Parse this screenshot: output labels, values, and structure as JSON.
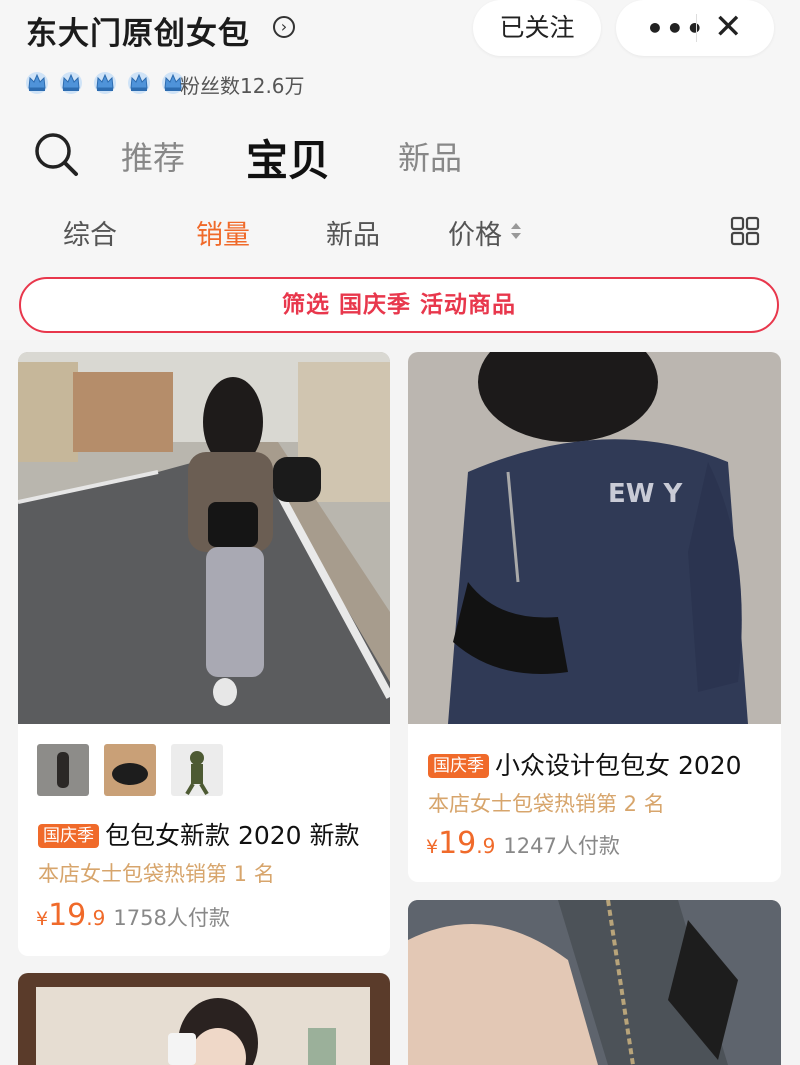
{
  "shop": {
    "name": "东大门原创女包",
    "fans": "粉丝数12.6万",
    "crown_count": 5,
    "follow_label": "已关注"
  },
  "capsule": {
    "more_label": "•••",
    "close_label": "✕"
  },
  "tabs": [
    {
      "label": "推荐",
      "active": false
    },
    {
      "label": "宝贝",
      "active": true
    },
    {
      "label": "新品",
      "active": false
    }
  ],
  "sort": [
    {
      "label": "综合",
      "active": false
    },
    {
      "label": "销量",
      "active": true
    },
    {
      "label": "新品",
      "active": false
    },
    {
      "label": "价格",
      "active": false
    }
  ],
  "filter_label": "筛选 国庆季 活动商品",
  "products": [
    {
      "badge": "国庆季",
      "title": "包包女新款 2020 新款",
      "rank": "本店女士包袋热销第 1 名",
      "currency": "¥",
      "price_int": "19",
      "price_dec": ".9",
      "sold": "1758人付款"
    },
    {
      "badge": "国庆季",
      "title": "小众设计包包女 2020",
      "rank": "本店女士包袋热销第 2 名",
      "currency": "¥",
      "price_int": "19",
      "price_dec": ".9",
      "sold": "1247人付款"
    }
  ],
  "colors": {
    "accent": "#f06a2a",
    "filter": "#e8374c",
    "rank": "#d7a56c"
  },
  "icons": [
    "chevron-right-circle-icon",
    "crown-icon",
    "search-icon",
    "sort-arrows-icon",
    "grid-view-icon",
    "more-icon",
    "close-icon"
  ]
}
